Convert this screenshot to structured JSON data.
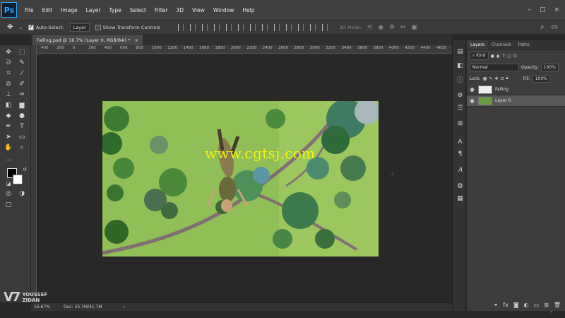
{
  "app": {
    "logo": "Ps",
    "menu": [
      "File",
      "Edit",
      "Image",
      "Layer",
      "Type",
      "Select",
      "Filter",
      "3D",
      "View",
      "Window",
      "Help"
    ]
  },
  "options": {
    "auto_select_label": "Auto-Select:",
    "auto_select_value": "Layer",
    "transform_label": "Show Transform Controls",
    "mode_3d_label": "3D Mode:"
  },
  "document": {
    "tab_title": "Falling.psd @ 16.7% (Layer 0, RGB/8#) *",
    "close_glyph": "×",
    "ruler_ticks": [
      "400",
      "200",
      "0",
      "200",
      "400",
      "600",
      "800",
      "1000",
      "1200",
      "1400",
      "1600",
      "1800",
      "2000",
      "2200",
      "2400",
      "2600",
      "2800",
      "3000",
      "3200",
      "3400",
      "3600",
      "3800",
      "4000",
      "4200",
      "4400",
      "4600"
    ],
    "watermark": "www.cgtsj.com"
  },
  "status": {
    "zoom": "16.67%",
    "doc": "Doc: 25.7M/41.7M"
  },
  "brand": {
    "mark": "V7",
    "name_line1": "YOUSSEF",
    "name_line2": "ZIDAN"
  },
  "udemy": "udemy",
  "layers_panel": {
    "tabs": [
      "Layers",
      "Channels",
      "Paths"
    ],
    "filter_kind": "Kind",
    "blend_mode": "Normal",
    "opacity_label": "Opacity:",
    "opacity_value": "100%",
    "lock_label": "Lock:",
    "fill_label": "Fill:",
    "fill_value": "100%",
    "layers": [
      {
        "name": "Falling",
        "selected": false
      },
      {
        "name": "Layer 0",
        "selected": true
      }
    ]
  },
  "colors": {
    "foreground": "#000000",
    "background": "#ffffff",
    "watermark": "#f3f20f"
  }
}
